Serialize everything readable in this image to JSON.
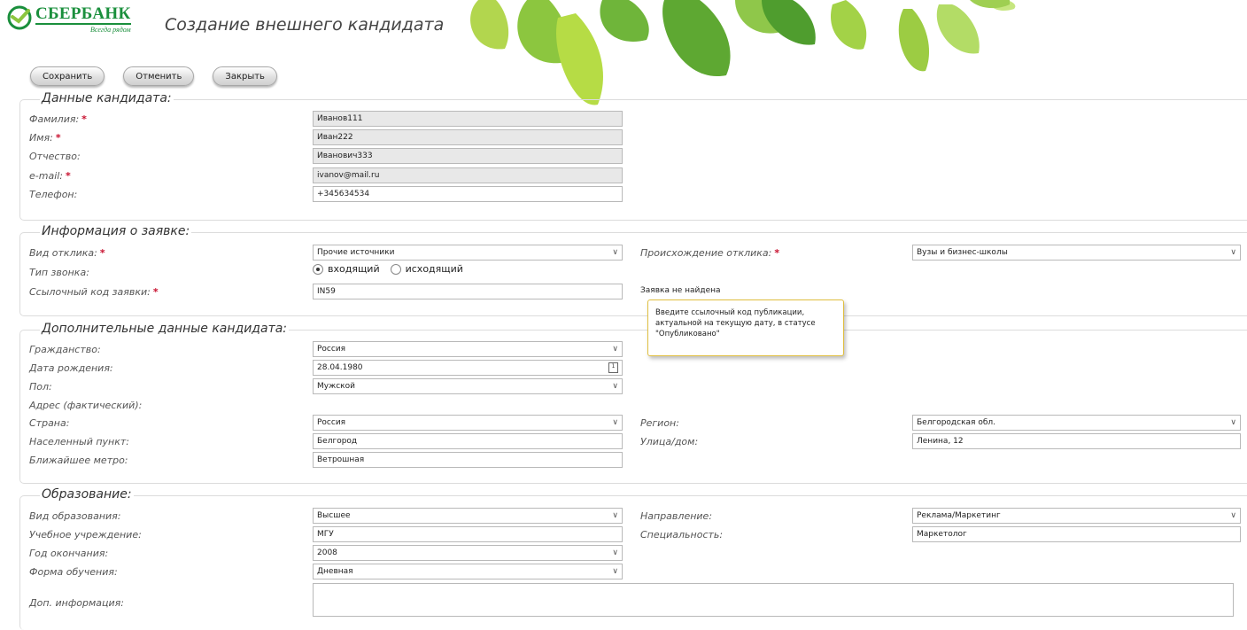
{
  "header": {
    "brand_name": "СБЕРБАНК",
    "brand_slogan": "Всегда рядом",
    "page_title": "Создание внешнего кандидата"
  },
  "toolbar": {
    "save_label": "Сохранить",
    "cancel_label": "Отменить",
    "close_label": "Закрыть"
  },
  "candidate": {
    "title": "Данные кандидата:",
    "last_name_label": "Фамилия:",
    "last_name_value": "Иванов111",
    "first_name_label": "Имя:",
    "first_name_value": "Иван222",
    "middle_name_label": "Отчество:",
    "middle_name_value": "Иванович333",
    "email_label": "e-mail:",
    "email_value": "ivanov@mail.ru",
    "phone_label": "Телефон:",
    "phone_value": "+345634534"
  },
  "application": {
    "title": "Информация о заявке:",
    "response_type_label": "Вид отклика:",
    "response_type_value": "Прочие источники",
    "response_origin_label": "Происхождение отклика:",
    "response_origin_value": "Вузы и бизнес-школы",
    "call_type_label": "Тип звонка:",
    "call_incoming": "входящий",
    "call_outgoing": "исходящий",
    "ref_code_label": "Ссылочный код заявки:",
    "ref_code_value": "IN59",
    "status_text": "Заявка не найдена"
  },
  "tooltip": {
    "text": "Введите ссылочный код публикации, актуальной на текущую дату, в статусе \"Опубликовано\""
  },
  "additional": {
    "title": "Дополнительные данные кандидата:",
    "citizenship_label": "Гражданство:",
    "citizenship_value": "Россия",
    "birth_date_label": "Дата рождения:",
    "birth_date_value": "28.04.1980",
    "gender_label": "Пол:",
    "gender_value": "Мужской",
    "address_label": "Адрес (фактический):",
    "country_label": "Страна:",
    "country_value": "Россия",
    "region_label": "Регион:",
    "region_value": "Белгородская обл.",
    "city_label": "Населенный пункт:",
    "city_value": "Белгород",
    "street_label": "Улица/дом:",
    "street_value": "Ленина, 12",
    "metro_label": "Ближайшее метро:",
    "metro_value": "Ветрошная"
  },
  "education": {
    "title": "Образование:",
    "edu_type_label": "Вид образования:",
    "edu_type_value": "Высшее",
    "direction_label": "Направление:",
    "direction_value": "Реклама/Маркетинг",
    "institution_label": "Учебное учреждение:",
    "institution_value": "МГУ",
    "specialty_label": "Специальность:",
    "specialty_value": "Маркетолог",
    "grad_year_label": "Год окончания:",
    "grad_year_value": "2008",
    "study_form_label": "Форма обучения:",
    "study_form_value": "Дневная",
    "extra_info_label": "Доп. информация:"
  },
  "colors": {
    "brand_green": "#1a8f3c",
    "required_red": "#c8102e",
    "tooltip_border": "#e0bf40"
  }
}
